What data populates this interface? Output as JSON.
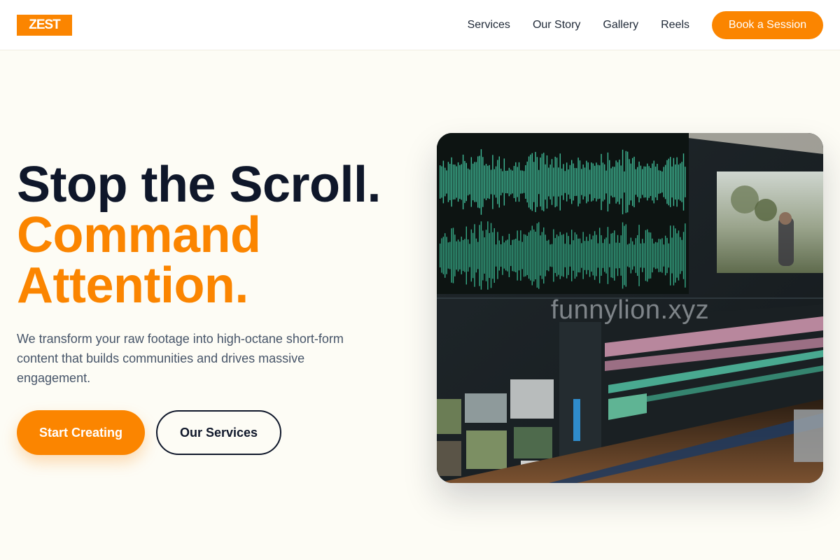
{
  "brand": {
    "logo_text": "ZEST",
    "accent": "#fb8500",
    "dark": "#0f172a"
  },
  "nav": {
    "links": [
      "Services",
      "Our Story",
      "Gallery",
      "Reels"
    ],
    "cta_label": "Book a Session"
  },
  "hero": {
    "title_line1": "Stop the Scroll.",
    "title_line2": "Command",
    "title_line3": "Attention.",
    "description": "We transform your raw footage into high-octane short-form content that builds communities and drives massive engagement.",
    "primary_label": "Start Creating",
    "secondary_label": "Our Services",
    "image_watermark": "funnylion.xyz",
    "image_subject": "video-editing-timeline-monitor"
  }
}
